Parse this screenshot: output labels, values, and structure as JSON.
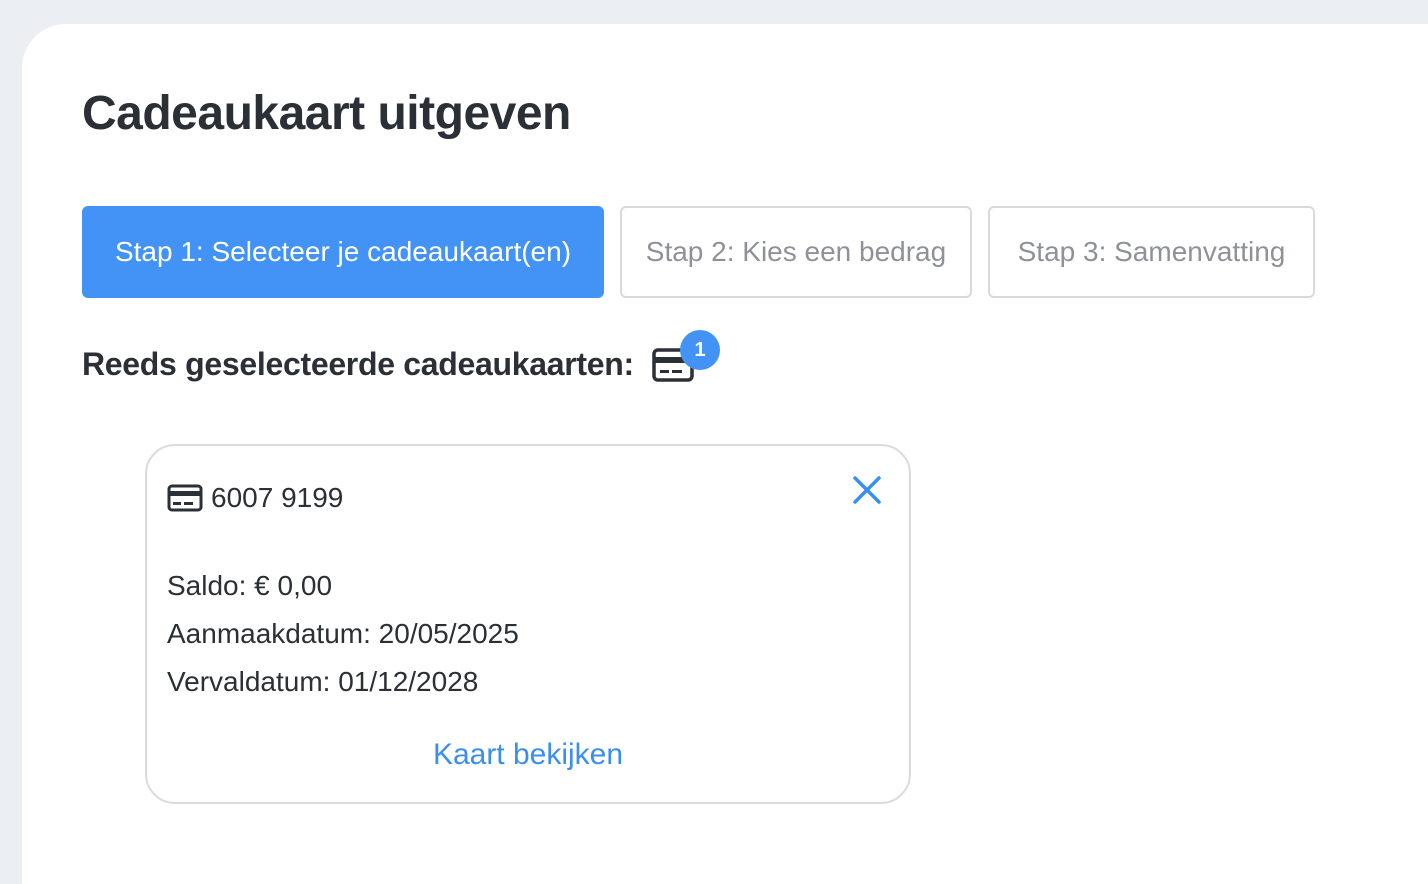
{
  "page": {
    "title": "Cadeaukaart uitgeven"
  },
  "steps": [
    {
      "label": "Stap 1: Selecteer je cadeaukaart(en)",
      "active": true
    },
    {
      "label": "Stap 2: Kies een bedrag",
      "active": false
    },
    {
      "label": "Stap 3: Samenvatting",
      "active": false
    }
  ],
  "selected": {
    "heading": "Reeds geselecteerde cadeaukaarten:",
    "icon": "credit-card-icon",
    "count": "1"
  },
  "cards": [
    {
      "number": "6007 9199",
      "icon": "credit-card-icon",
      "balance": "Saldo: € 0,00",
      "created": "Aanmaakdatum: 20/05/2025",
      "expires": "Vervaldatum: 01/12/2028",
      "link": "Kaart bekijken",
      "remove_icon": "close-icon"
    }
  ],
  "colors": {
    "accent": "#4293f5",
    "text": "#2b2f36",
    "muted": "#8e9298",
    "background": "#ebeff3"
  }
}
